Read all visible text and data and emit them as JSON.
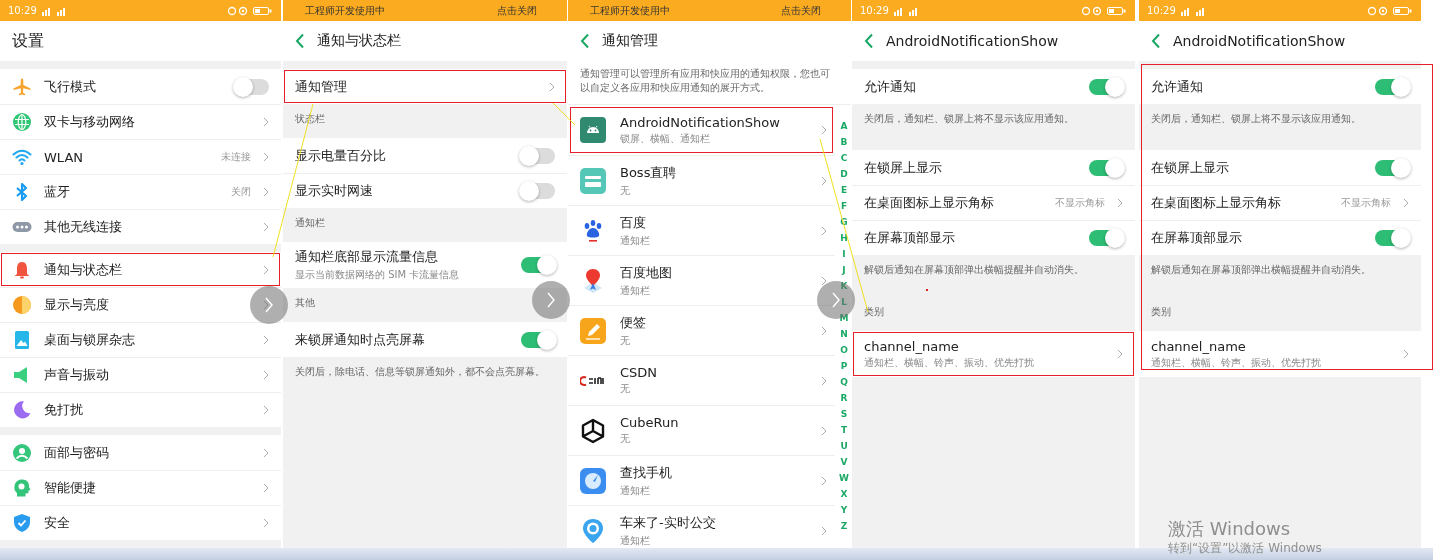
{
  "screens": [
    {
      "kind": "home",
      "top": {
        "kind": "status",
        "time": "10:29"
      },
      "header": {
        "title": "设置",
        "back": false
      },
      "highlighted": false,
      "blocks": [
        {
          "kind": "group",
          "rows": [
            {
              "label": "飞行模式",
              "kind": "toggle",
              "on": false,
              "highlighted": false
            },
            {
              "label": "双卡与移动网络",
              "kind": "chevron",
              "highlighted": false
            },
            {
              "label": "WLAN",
              "value": "未连接",
              "kind": "chevron",
              "highlighted": false
            },
            {
              "label": "蓝牙",
              "value": "关闭",
              "kind": "chevron",
              "highlighted": false
            },
            {
              "label": "其他无线连接",
              "kind": "chevron",
              "highlighted": false
            }
          ]
        },
        {
          "kind": "group",
          "rows": [
            {
              "label": "通知与状态栏",
              "kind": "chevron",
              "highlighted": true
            },
            {
              "label": "显示与亮度",
              "kind": "chevron",
              "highlighted": false
            },
            {
              "label": "桌面与锁屏杂志",
              "kind": "chevron",
              "highlighted": false
            },
            {
              "label": "声音与振动",
              "kind": "chevron",
              "highlighted": false
            },
            {
              "label": "免打扰",
              "kind": "chevron",
              "highlighted": false
            }
          ]
        },
        {
          "kind": "group",
          "rows": [
            {
              "label": "面部与密码",
              "kind": "chevron",
              "highlighted": false
            },
            {
              "label": "智能便捷",
              "kind": "chevron",
              "highlighted": false
            },
            {
              "label": "安全",
              "kind": "chevron",
              "highlighted": false
            }
          ]
        }
      ]
    },
    {
      "kind": "settings",
      "top": {
        "kind": "banner",
        "text": "工程师开发使用中",
        "action": "点击关闭"
      },
      "header": {
        "title": "通知与状态栏",
        "back": true
      },
      "highlighted": false,
      "blocks": [
        {
          "kind": "group",
          "rows": [
            {
              "label": "通知管理",
              "kind": "chevron",
              "highlighted": true
            }
          ]
        },
        {
          "kind": "label",
          "text": "状态栏"
        },
        {
          "kind": "group",
          "rows": [
            {
              "label": "显示电量百分比",
              "kind": "toggle",
              "on": false,
              "highlighted": false
            },
            {
              "label": "显示实时网速",
              "kind": "toggle",
              "on": false,
              "highlighted": false
            }
          ]
        },
        {
          "kind": "label",
          "text": "通知栏"
        },
        {
          "kind": "group",
          "rows": [
            {
              "label": "通知栏底部显示流量信息",
              "sub": "显示当前数据网络的 SIM 卡流量信息",
              "kind": "toggle",
              "on": true,
              "highlighted": false
            }
          ]
        },
        {
          "kind": "label",
          "text": "其他"
        },
        {
          "kind": "group",
          "rows": [
            {
              "label": "来锁屏通知时点亮屏幕",
              "kind": "toggle",
              "on": true,
              "highlighted": false
            }
          ]
        },
        {
          "kind": "note",
          "text": "关闭后，除电话、信息等锁屏通知外，都不会点亮屏幕。"
        }
      ]
    },
    {
      "kind": "apps",
      "top": {
        "kind": "banner",
        "text": "工程师开发使用中",
        "action": "点击关闭"
      },
      "header": {
        "title": "通知管理",
        "back": true
      },
      "highlighted": false,
      "index_letters": [
        "A",
        "B",
        "C",
        "D",
        "E",
        "F",
        "G",
        "H",
        "I",
        "J",
        "K",
        "L",
        "M",
        "N",
        "O",
        "P",
        "Q",
        "R",
        "S",
        "T",
        "U",
        "V",
        "W",
        "X",
        "Y",
        "Z"
      ],
      "blocks": [
        {
          "kind": "intro",
          "text": "通知管理可以管理所有应用和快应用的通知权限，您也可以自定义各应用和快应用通知的展开方式。"
        },
        {
          "kind": "group",
          "rows": [
            {
              "label": "AndroidNotificationShow",
              "sub": "锁屏、横幅、通知栏",
              "kind": "chevron",
              "highlighted": true
            },
            {
              "label": "Boss直聘",
              "sub": "无",
              "kind": "chevron",
              "highlighted": false
            },
            {
              "label": "百度",
              "sub": "通知栏",
              "kind": "chevron",
              "highlighted": false
            },
            {
              "label": "百度地图",
              "sub": "通知栏",
              "kind": "chevron",
              "highlighted": false
            },
            {
              "label": "便签",
              "sub": "无",
              "kind": "chevron",
              "highlighted": false
            },
            {
              "label": "CSDN",
              "sub": "无",
              "kind": "chevron",
              "highlighted": false
            },
            {
              "label": "CubeRun",
              "sub": "无",
              "kind": "chevron",
              "highlighted": false
            },
            {
              "label": "查找手机",
              "sub": "通知栏",
              "kind": "chevron",
              "highlighted": false
            },
            {
              "label": "车来了-实时公交",
              "sub": "通知栏",
              "kind": "chevron",
              "highlighted": false
            }
          ]
        }
      ]
    },
    {
      "kind": "settings",
      "top": {
        "kind": "status",
        "time": "10:29"
      },
      "header": {
        "title": "AndroidNotificationShow",
        "back": true
      },
      "highlighted": false,
      "blocks": [
        {
          "kind": "group",
          "rows": [
            {
              "label": "允许通知",
              "kind": "toggle",
              "on": true,
              "highlighted": false
            }
          ]
        },
        {
          "kind": "note",
          "text": "关闭后，通知栏、锁屏上将不显示该应用通知。"
        },
        {
          "kind": "group",
          "rows": [
            {
              "label": "在锁屏上显示",
              "kind": "toggle",
              "on": true,
              "highlighted": false
            },
            {
              "label": "在桌面图标上显示角标",
              "value": "不显示角标",
              "kind": "chevron",
              "highlighted": false
            },
            {
              "label": "在屏幕顶部显示",
              "kind": "toggle",
              "on": true,
              "highlighted": false
            }
          ]
        },
        {
          "kind": "note",
          "text": "解锁后通知在屏幕顶部弹出横幅提醒并自动消失。"
        },
        {
          "kind": "label",
          "text": "类别"
        },
        {
          "kind": "group",
          "rows": [
            {
              "label": "channel_name",
              "sub": "通知栏、横幅、铃声、振动、优先打扰",
              "kind": "chevron",
              "highlighted": true
            }
          ]
        }
      ]
    },
    {
      "kind": "settings",
      "top": {
        "kind": "status",
        "time": "10:29"
      },
      "header": {
        "title": "AndroidNotificationShow",
        "back": true
      },
      "highlighted": true,
      "blocks": [
        {
          "kind": "group",
          "rows": [
            {
              "label": "允许通知",
              "kind": "toggle",
              "on": true,
              "highlighted": false
            }
          ]
        },
        {
          "kind": "note",
          "text": "关闭后，通知栏、锁屏上将不显示该应用通知。"
        },
        {
          "kind": "group",
          "rows": [
            {
              "label": "在锁屏上显示",
              "kind": "toggle",
              "on": true,
              "highlighted": false
            },
            {
              "label": "在桌面图标上显示角标",
              "value": "不显示角标",
              "kind": "chevron",
              "highlighted": false
            },
            {
              "label": "在屏幕顶部显示",
              "kind": "toggle",
              "on": true,
              "highlighted": false
            }
          ]
        },
        {
          "kind": "note",
          "text": "解锁后通知在屏幕顶部弹出横幅提醒并自动消失。"
        },
        {
          "kind": "label",
          "text": "类别"
        },
        {
          "kind": "group",
          "rows": [
            {
              "label": "channel_name",
              "sub": "通知栏、横幅、铃声、振动、优先打扰",
              "kind": "chevron",
              "highlighted": false
            }
          ]
        }
      ]
    }
  ],
  "system_overlay": {
    "lines": [
      "激活 Windows",
      "转到“设置”以激活 Windows"
    ]
  }
}
